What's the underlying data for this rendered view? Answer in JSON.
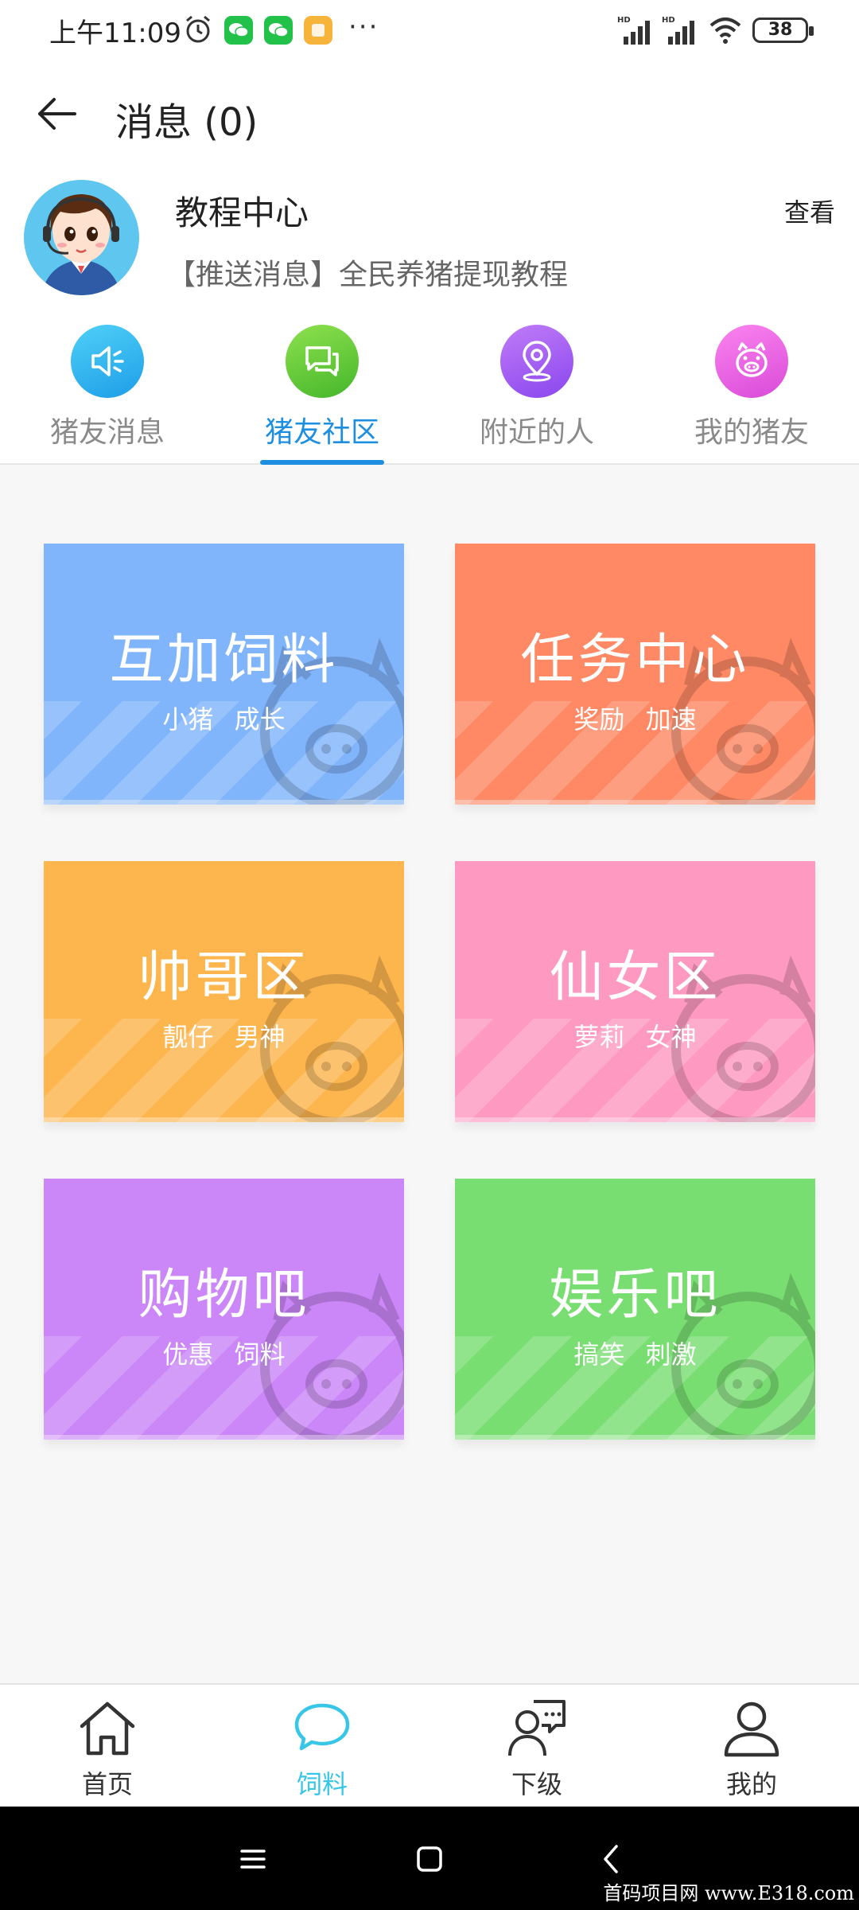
{
  "status_bar": {
    "time": "上午11:09",
    "battery": "38",
    "more": "···"
  },
  "header": {
    "title": "消息 (0)"
  },
  "notice": {
    "title": "教程中心",
    "view_label": "查看",
    "message": "【推送消息】全民养猪提现教程"
  },
  "tabs": [
    {
      "label": "猪友消息",
      "icon": "speaker-icon",
      "color": "#2ab3ef"
    },
    {
      "label": "猪友社区",
      "icon": "chat-icon",
      "color": "#62cd38",
      "active": true
    },
    {
      "label": "附近的人",
      "icon": "location-icon",
      "color": "#a760f4"
    },
    {
      "label": "我的猪友",
      "icon": "pig-icon",
      "color": "#f062e2"
    }
  ],
  "cards": [
    {
      "title": "互加饲料",
      "subtitle": "小猪  成长",
      "color": "#80b4fb"
    },
    {
      "title": "任务中心",
      "subtitle": "奖励  加速",
      "color": "#fe8964"
    },
    {
      "title": "帅哥区",
      "subtitle": "靓仔  男神",
      "color": "#fdb54e"
    },
    {
      "title": "仙女区",
      "subtitle": "萝莉  女神",
      "color": "#fe9ac1"
    },
    {
      "title": "购物吧",
      "subtitle": "优惠  饲料",
      "color": "#cb87f8"
    },
    {
      "title": "娱乐吧",
      "subtitle": "搞笑  刺激",
      "color": "#79de72"
    }
  ],
  "bottom_nav": [
    {
      "label": "首页",
      "icon": "home-icon"
    },
    {
      "label": "饲料",
      "icon": "feed-chat-icon",
      "active": true,
      "color": "#38c6e6"
    },
    {
      "label": "下级",
      "icon": "subordinates-icon"
    },
    {
      "label": "我的",
      "icon": "profile-icon"
    }
  ],
  "watermark": "首码项目网 www.E318.com"
}
